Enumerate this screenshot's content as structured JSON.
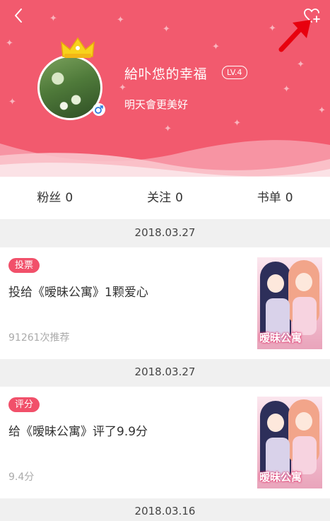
{
  "profile": {
    "name": "給卟怹的幸福",
    "level": "LV.4",
    "bio": "明天會更美好"
  },
  "stats": [
    {
      "label": "粉丝",
      "value": "0"
    },
    {
      "label": "关注",
      "value": "0"
    },
    {
      "label": "书单",
      "value": "0"
    }
  ],
  "feed": [
    {
      "date": "2018.03.27",
      "tag": "投票",
      "title": "投给《暧昧公寓》1颗爱心",
      "meta": "91261次推荐",
      "cover_text": "暧昧公寓"
    },
    {
      "date": "2018.03.27",
      "tag": "评分",
      "title": "给《暧昧公寓》评了9.9分",
      "meta": "9.4分",
      "cover_text": "暧昧公寓"
    },
    {
      "date": "2018.03.16"
    }
  ],
  "icons": {
    "back": "back-chevron-icon",
    "favorite": "heart-plus-icon",
    "crown": "crown-icon",
    "gender": "male-gender-icon"
  },
  "colors": {
    "header_bg": "#f25a6e",
    "tag_bg": "#f1506a"
  }
}
